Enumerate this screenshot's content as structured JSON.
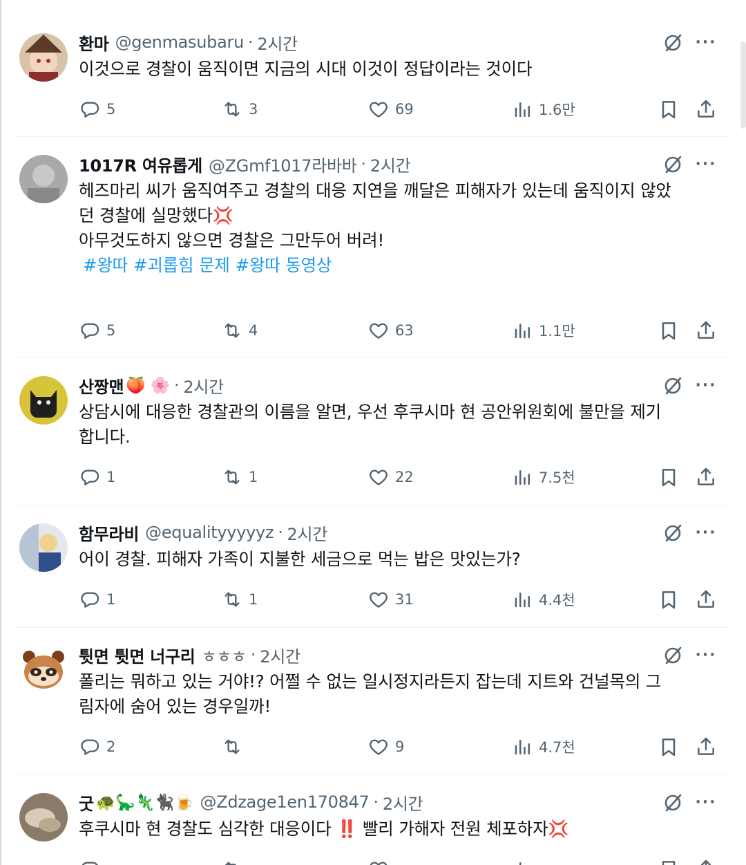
{
  "replies": [
    {
      "name": "환마",
      "handle": "@genmasubaru",
      "time": "2시간",
      "lines": [
        "이것으로 경찰이 움직이면 지금의 시대 이것이 정답이라는 것이다"
      ],
      "stats": {
        "replies": "5",
        "retweets": "3",
        "likes": "69",
        "views": "1.6만"
      },
      "avatar_color": "#b98d6a"
    },
    {
      "name": "1017R 여유롭게",
      "handle": "@ZGmf1017라바바",
      "time": "2시간",
      "lines": [
        "헤즈마리 씨가 움직여주고 경찰의 대응 지연을 깨달은 피해자가 있는데 움직이지 않았",
        "던 경찰에 실망했다💢",
        "아무것도하지 않으면 경찰은 그만두어 버려!"
      ],
      "hashtags": [
        "#왕따",
        "#괴롭힘 문제",
        "#왕따 동영상"
      ],
      "stats": {
        "replies": "5",
        "retweets": "4",
        "likes": "63",
        "views": "1.1만"
      },
      "avatar_color": "#9a9a9a"
    },
    {
      "name": "산짱맨",
      "name_emoji": "🍑 🌸",
      "handle": "",
      "time": "2시간",
      "lines": [
        "상담시에 대응한 경찰관의 이름을 알면, 우선 후쿠시마 현 공안위원회에 불만을 제기",
        "합니다."
      ],
      "stats": {
        "replies": "1",
        "retweets": "1",
        "likes": "22",
        "views": "7.5천"
      },
      "avatar_color": "#c9b02a"
    },
    {
      "name": "함무라비",
      "handle": "@equalityyyyyz",
      "time": "2시간",
      "lines": [
        "어이 경찰. 피해자 가족이 지불한 세금으로 먹는 밥은 맛있는가?"
      ],
      "stats": {
        "replies": "1",
        "retweets": "1",
        "likes": "31",
        "views": "4.4천"
      },
      "avatar_color": "#3a6ea5"
    },
    {
      "name": "튓면 튓면 너구리",
      "handle": "ㅎㅎㅎ",
      "time": "2시간",
      "lines": [
        "폴리는 뭐하고 있는 거야!? 어쩔 수 없는 일시정지라든지 잡는데 지트와 건널목의 그",
        "림자에 숨어 있는 경우일까!"
      ],
      "stats": {
        "replies": "2",
        "retweets": "",
        "likes": "9",
        "views": "4.7천"
      },
      "avatar_color": "#c8844a"
    },
    {
      "name": "굿",
      "name_emoji": "🐢🦕🦎🐈‍⬛🍺",
      "handle": "@Zdzage1en170847",
      "time": "2시간",
      "lines": [
        "후쿠시마 현 경찰도 심각한 대응이다 ‼️ 빨리 가해자 전원 체포하자💢"
      ],
      "stats": {
        "replies": "",
        "retweets": "",
        "likes": "",
        "views": ""
      },
      "avatar_color": "#8a7b68"
    }
  ],
  "colors": {
    "text": "#0f1419",
    "muted": "#536471",
    "link": "#1d9bf0",
    "divider": "#eff3f4"
  }
}
